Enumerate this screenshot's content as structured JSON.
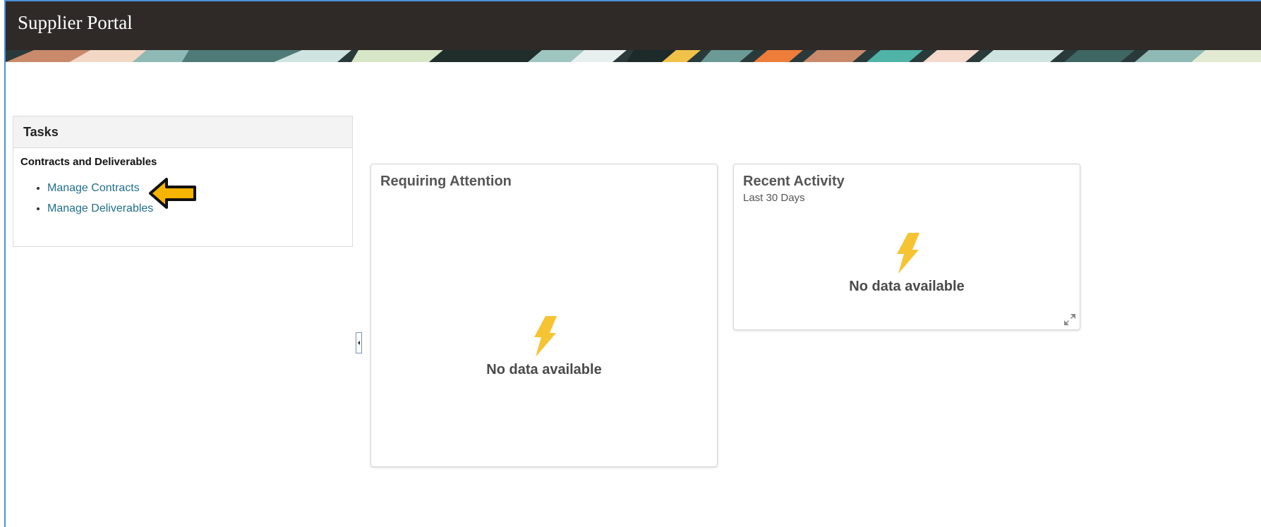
{
  "header": {
    "title": "Supplier Portal"
  },
  "tasks": {
    "title": "Tasks",
    "section": "Contracts and Deliverables",
    "links": [
      {
        "label": "Manage Contracts"
      },
      {
        "label": "Manage Deliverables"
      }
    ]
  },
  "requiring_attention": {
    "title": "Requiring Attention",
    "empty_text": "No data available"
  },
  "recent_activity": {
    "title": "Recent Activity",
    "subtitle": "Last 30 Days",
    "empty_text": "No data available"
  },
  "colors": {
    "header_bg": "#2f2a27",
    "link": "#1f6f8b",
    "lightning": "#f6c333",
    "arrow_fill": "#f5b400"
  },
  "icons": {
    "empty_state": "lightning-icon",
    "pointer": "arrow-left-icon",
    "expand": "expand-icon",
    "collapse": "collapse-pane-icon"
  }
}
